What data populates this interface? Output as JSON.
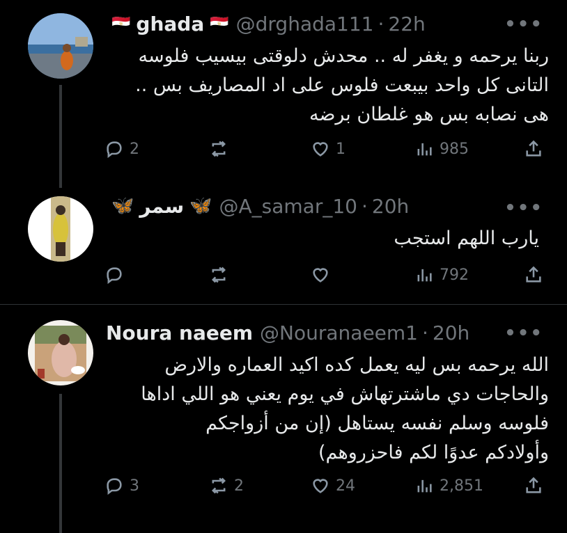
{
  "tweets": [
    {
      "name": "ghada",
      "name_prefix": "🇪🇬",
      "name_suffix": "🇪🇬",
      "handle": "@drghada111",
      "time": "22h",
      "more": "•••",
      "lines": [
        "ربنا يرحمه و يغفر له .. محدش دلوقتى بيسيب فلوسه",
        "التانى كل واحد بيبعت فلوس على اد المصاريف بس ..",
        "هى نصابه بس هو غلطان برضه"
      ],
      "replies": "2",
      "reposts": "",
      "likes": "1",
      "views": "985"
    },
    {
      "name": "سمر",
      "name_prefix": "🦋",
      "name_suffix": "🦋",
      "handle": "@A_samar_10",
      "time": "20h",
      "more": "•••",
      "lines": [
        "يارب اللهم استجب"
      ],
      "replies": "",
      "reposts": "",
      "likes": "",
      "views": "792"
    },
    {
      "name": "Noura naeem",
      "handle": "@Nouranaeem1",
      "time": "20h",
      "more": "•••",
      "lines": [
        "الله يرحمه بس ليه يعمل كده اكيد العماره والارض",
        "والحاجات دي ماشترتهاش في يوم يعني هو اللي اداها",
        "فلوسه وسلم نفسه يستاهل (إن من أزواجكم",
        "وأولادكم عدوًا لكم فاحزروهم)"
      ],
      "replies": "3",
      "reposts": "2",
      "likes": "24",
      "views": "2,851"
    }
  ],
  "colors": {
    "background": "#000000",
    "text": "#e7e9ea",
    "muted": "#71767b",
    "divider": "#2f3336",
    "thread_line": "#333639",
    "butterfly": "#4aa8ff"
  },
  "icons": [
    "reply-icon",
    "repost-icon",
    "like-icon",
    "views-icon",
    "share-icon",
    "more-icon"
  ]
}
